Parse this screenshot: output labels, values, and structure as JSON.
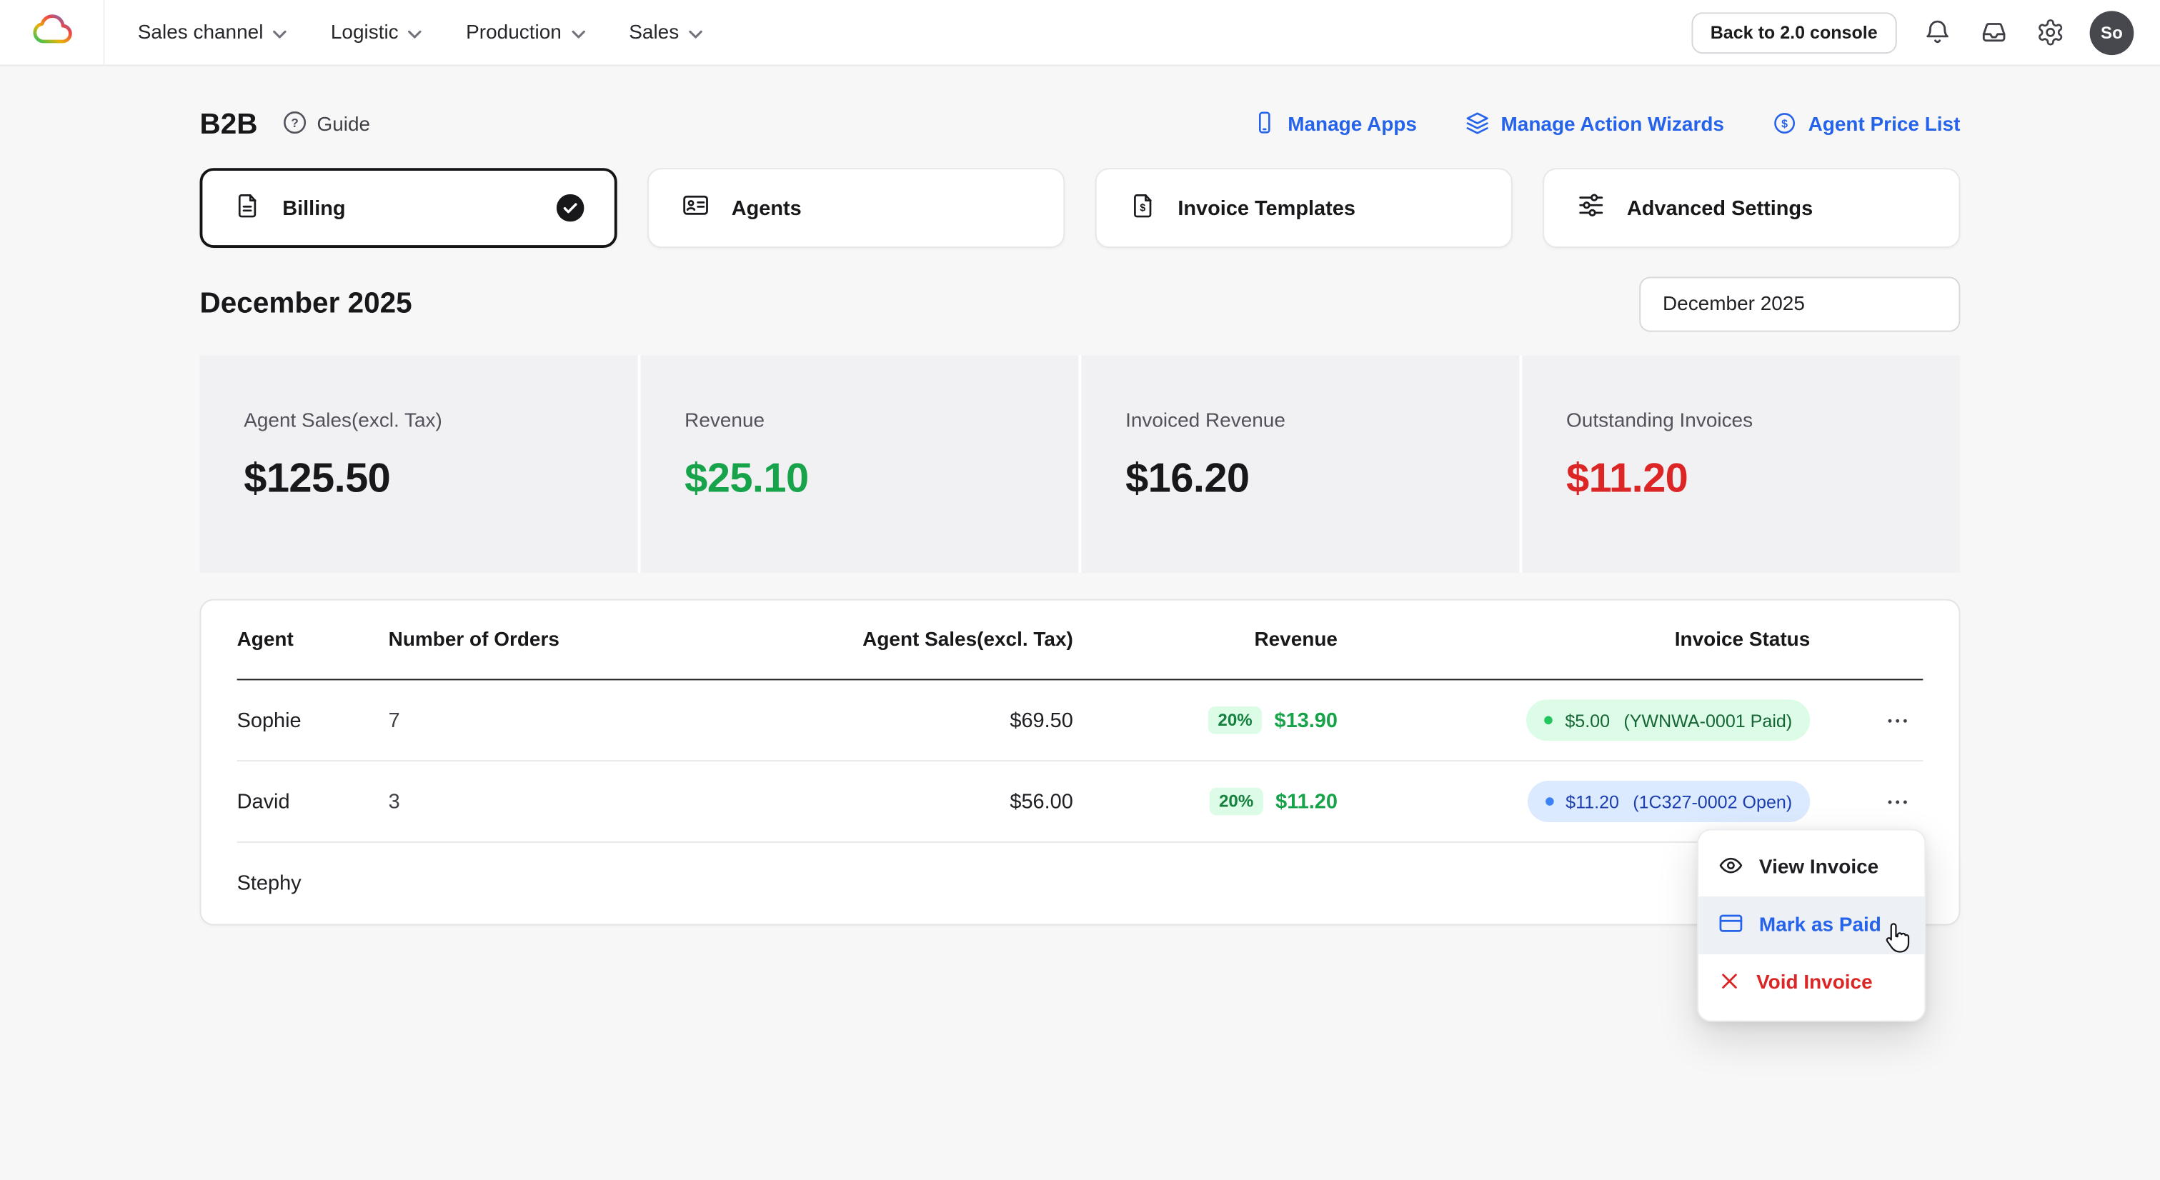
{
  "colors": {
    "accent_blue": "#2563eb",
    "positive_green": "#16a34a",
    "negative_red": "#dc2626",
    "paid_pill_bg": "#dcfce7",
    "open_pill_bg": "#dbeafe",
    "page_bg": "#f7f7f8"
  },
  "icons": {
    "logo": "cloud-rainbow-icon",
    "nav_caret": "chevron-down-icon",
    "topbar_right": [
      "bell-icon",
      "inbox-icon",
      "gear-icon"
    ],
    "header_links": [
      "phone-icon",
      "layers-icon",
      "dollar-circle-icon"
    ],
    "tabs": [
      "document-icon",
      "id-card-icon",
      "invoice-dollar-icon",
      "sliders-icon"
    ],
    "menu": [
      "eye-icon",
      "credit-card-icon",
      "x-icon"
    ],
    "row_actions": "ellipsis-icon"
  },
  "topbar": {
    "nav_items": [
      {
        "label": "Sales channel"
      },
      {
        "label": "Logistic"
      },
      {
        "label": "Production"
      },
      {
        "label": "Sales"
      }
    ],
    "back_button_label": "Back to 2.0 console",
    "avatar_initials": "So"
  },
  "header": {
    "title": "B2B",
    "guide_label": "Guide",
    "actions": [
      {
        "label": "Manage Apps"
      },
      {
        "label": "Manage Action Wizards"
      },
      {
        "label": "Agent Price List"
      }
    ]
  },
  "tabs": [
    {
      "label": "Billing",
      "selected": true
    },
    {
      "label": "Agents",
      "selected": false
    },
    {
      "label": "Invoice Templates",
      "selected": false
    },
    {
      "label": "Advanced Settings",
      "selected": false
    }
  ],
  "period": {
    "heading": "December 2025",
    "selector_value": "December 2025"
  },
  "stats": [
    {
      "label": "Agent Sales(excl. Tax)",
      "value": "$125.50",
      "color": "#18181b"
    },
    {
      "label": "Revenue",
      "value": "$25.10",
      "color": "#16a34a"
    },
    {
      "label": "Invoiced Revenue",
      "value": "$16.20",
      "color": "#18181b"
    },
    {
      "label": "Outstanding Invoices",
      "value": "$11.20",
      "color": "#dc2626"
    }
  ],
  "table": {
    "headers": [
      "Agent",
      "Number of Orders",
      "Agent Sales(excl. Tax)",
      "Revenue",
      "Invoice Status"
    ],
    "rows": [
      {
        "agent": "Sophie",
        "orders": "7",
        "sales": "$69.50",
        "revenue_pct": "20%",
        "revenue": "$13.90",
        "status_amount": "$5.00",
        "status_ref": "(YWNWA-0001 Paid)",
        "status_type": "paid"
      },
      {
        "agent": "David",
        "orders": "3",
        "sales": "$56.00",
        "revenue_pct": "20%",
        "revenue": "$11.20",
        "status_amount": "$11.20",
        "status_ref": "(1C327-0002 Open)",
        "status_type": "open"
      },
      {
        "agent": "Stephy",
        "orders": "",
        "sales": "",
        "revenue_pct": "",
        "revenue": "",
        "status_amount": "",
        "status_ref": "",
        "status_type": "none"
      }
    ]
  },
  "context_menu": {
    "items": [
      {
        "label": "View Invoice",
        "state": "default"
      },
      {
        "label": "Mark as Paid",
        "state": "active"
      },
      {
        "label": "Void Invoice",
        "state": "danger"
      }
    ]
  }
}
